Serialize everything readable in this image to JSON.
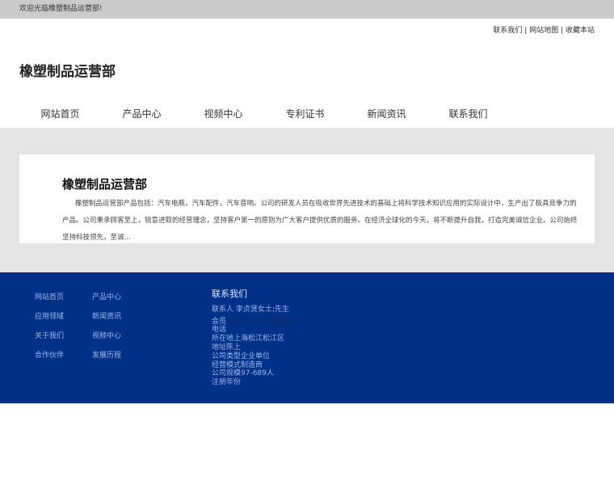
{
  "topbar": {
    "welcome": "欢迎光临橡塑制品运营部!"
  },
  "toplinks": [
    "联系我们",
    "网站地图",
    "收藏本站"
  ],
  "logo": "橡塑制品运营部",
  "nav": [
    "网站首页",
    "产品中心",
    "视频中心",
    "专利证书",
    "新闻资讯",
    "联系我们"
  ],
  "intro": {
    "title": "橡塑制品运营部",
    "text": "橡塑制品运营部产品包括：汽车电瓶，汽车配件，汽车音响。公司的研发人员在吸收世界先进技术的基础上将科学技术知识应用的实际设计中，生产出了极具竞争力的产品。公司秉承顾客至上，锐意进取的经营理念，坚持客户第一的原则为广大客户提供优质的服务。在经济全球化的今天，将不断提升自我，打造完美诚信企业。公司始终坚持科技领先，至诚..."
  },
  "footer": {
    "links": [
      "网站首页",
      "产品中心",
      "应用领域",
      "新闻资讯",
      "关于我们",
      "视频中心",
      "合作伙伴",
      "发展历程"
    ],
    "contact_title": "联系我们",
    "contact_person": "联系人 李贞贤女士;先生",
    "member_label": "会员",
    "add_friend": "[加为商友]",
    "send_mail": "[发送信件]",
    "lines": [
      "电话",
      "所在地上海松江松江区",
      "地址陈上",
      "公司类型企业单位",
      "经营模式制造商",
      "公司规模97-689人",
      "注册年份"
    ]
  }
}
